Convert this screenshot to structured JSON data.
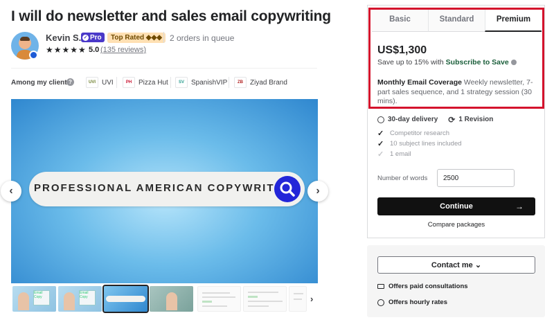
{
  "gig": {
    "title": "I will do newsletter and sales email copywriting"
  },
  "seller": {
    "name": "Kevin S.",
    "pro_label": "Pro",
    "top_rated_label": "Top Rated ◆◆◆",
    "queue_text": "2 orders in queue",
    "stars": "★★★★★",
    "rating": "5.0",
    "reviews_text": "(135 reviews)"
  },
  "clients": {
    "label": "Among my clients",
    "items": [
      {
        "name": "UVI",
        "logo_text": "UVI",
        "color": "#6b7d2a"
      },
      {
        "name": "Pizza Hut",
        "logo_text": "PH",
        "color": "#c8102e"
      },
      {
        "name": "SpanishVIP",
        "logo_text": "SV",
        "color": "#2a9d8f"
      },
      {
        "name": "Ziyad Brand",
        "logo_text": "ZB",
        "color": "#b22222"
      }
    ]
  },
  "hero": {
    "search_text": "PROFESSIONAL AMERICAN COPYWRITER",
    "prev_arrow": "‹",
    "next_arrow": "›"
  },
  "gallery": {
    "next_arrow": "›",
    "thumb1_caption": "Email Copy",
    "thumb2_caption": "Email Copy"
  },
  "packages": {
    "tabs": [
      "Basic",
      "Standard",
      "Premium"
    ],
    "active_tab": "Premium",
    "price": "US$1,300",
    "save_prefix": "Save up to 15% with ",
    "save_link": "Subscribe to Save",
    "desc_title": "Monthly Email Coverage",
    "desc_body": " Weekly newsletter, 7-part sales sequence, and 1 strategy session (30 mins).",
    "delivery": "30-day delivery",
    "revisions": "1 Revision",
    "features": [
      {
        "label": "Competitor research",
        "included": true
      },
      {
        "label": "10 subject lines included",
        "included": true
      },
      {
        "label": "1 email",
        "included": false
      }
    ],
    "words_label": "Number of words",
    "words_value": "2500",
    "continue_label": "Continue",
    "continue_arrow": "→",
    "compare_label": "Compare packages"
  },
  "contact": {
    "button_label": "Contact me ⌄",
    "offers": [
      "Offers paid consultations",
      "Offers hourly rates"
    ]
  },
  "colors": {
    "brand_green": "#1a5e3a",
    "highlight_red": "#d4122c",
    "pro_purple": "#4a39c9"
  }
}
